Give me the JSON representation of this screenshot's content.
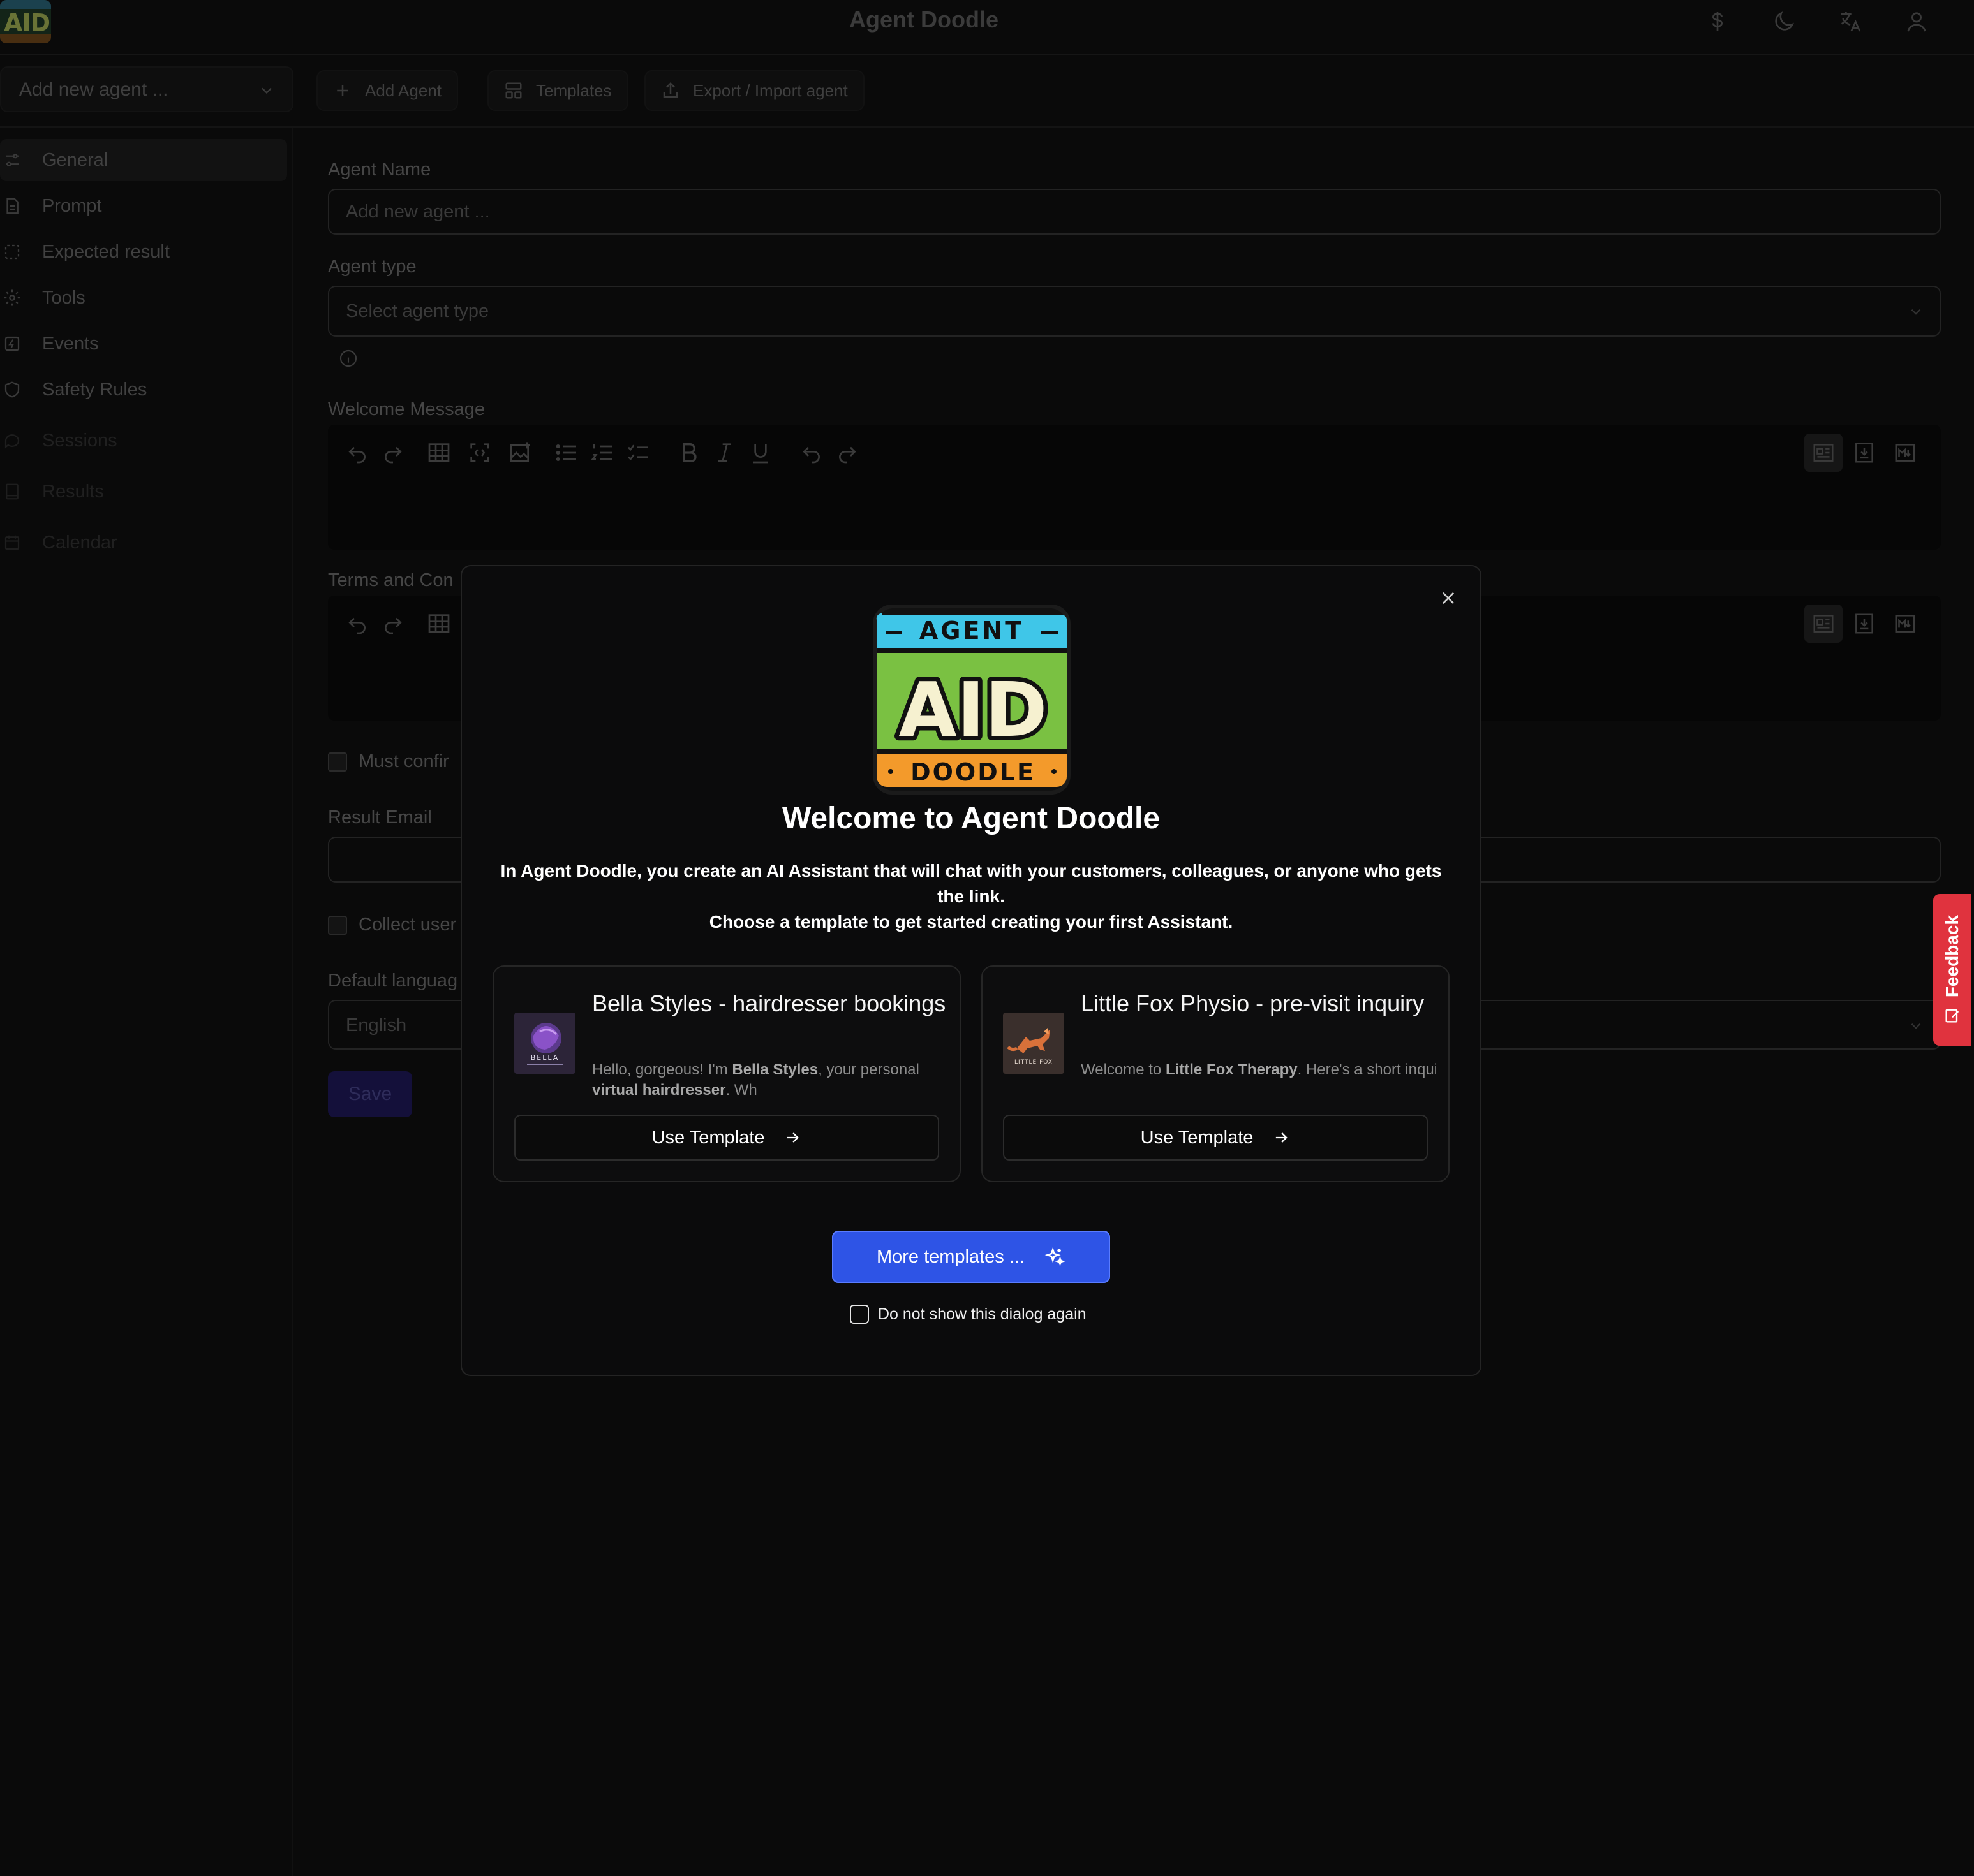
{
  "app": {
    "title": "Agent Doodle",
    "logo_lettering": "AGENT AID DOODLE"
  },
  "toolbar": {
    "agent_select": "Add new agent ...",
    "add_agent": "Add Agent",
    "templates": "Templates",
    "export_import": "Export / Import agent"
  },
  "sidebar": {
    "items": [
      {
        "label": "General",
        "icon": "sliders-icon"
      },
      {
        "label": "Prompt",
        "icon": "document-icon"
      },
      {
        "label": "Expected result",
        "icon": "dashed-square-icon"
      },
      {
        "label": "Tools",
        "icon": "gear-icon"
      },
      {
        "label": "Events",
        "icon": "bolt-icon"
      },
      {
        "label": "Safety Rules",
        "icon": "shield-icon"
      },
      {
        "label": "Sessions",
        "icon": "chat-icon"
      },
      {
        "label": "Results",
        "icon": "book-icon"
      },
      {
        "label": "Calendar",
        "icon": "calendar-icon"
      }
    ]
  },
  "form": {
    "agent_name_label": "Agent Name",
    "agent_name_placeholder": "Add new agent ...",
    "agent_type_label": "Agent type",
    "agent_type_placeholder": "Select agent type",
    "welcome_label": "Welcome Message",
    "terms_label": "Terms and Con",
    "must_confirm_label": "Must confir",
    "result_email_label": "Result Email",
    "collect_label": "Collect user",
    "default_lang_label": "Default languag",
    "default_lang_value": "English",
    "save": "Save"
  },
  "feedback": {
    "label": "Feedback"
  },
  "modal": {
    "title": "Welcome to Agent Doodle",
    "description_1": "In Agent Doodle, you create an AI Assistant that will chat with your customers, colleagues, or anyone who gets the link.",
    "description_2": "Choose a template to get started creating your first Assistant.",
    "cards": [
      {
        "title": "Bella Styles - hairdresser bookings",
        "desc_a": "Hello, gorgeous! I'm ",
        "desc_b": "Bella Styles",
        "desc_c": ", your personal ",
        "desc_d": "virtual hairdresser",
        "desc_e": ". Wh",
        "thumb_text": "BELLA",
        "button": "Use Template"
      },
      {
        "title": "Little Fox Physio - pre-visit inquiry",
        "desc_a": "Welcome to ",
        "desc_b": "Little Fox Therapy",
        "desc_c": ". Here's a short inquiry that will let us bette",
        "thumb_text": "LITTLE FOX",
        "button": "Use Template"
      }
    ],
    "more_templates": "More templates ...",
    "dont_show": "Do not show this dialog again"
  },
  "colors": {
    "accent": "#2e54e6",
    "feedback": "#e0333e",
    "logo_blue": "#3fc6e8",
    "logo_green": "#7ac142",
    "logo_orange": "#f39a2b"
  }
}
